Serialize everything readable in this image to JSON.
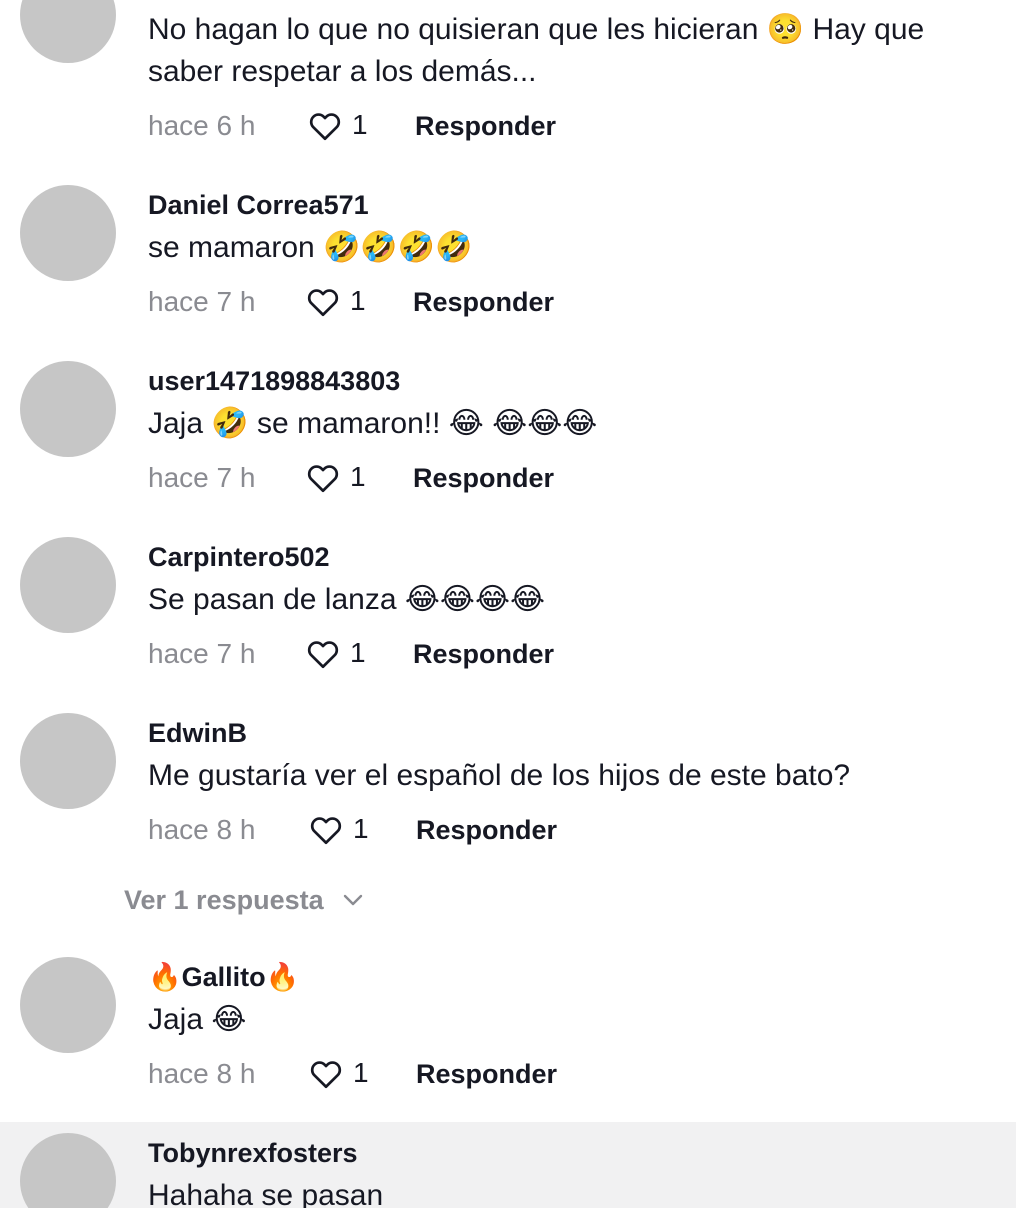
{
  "comments": [
    {
      "username": "",
      "text": "No hagan lo que no quisieran que les hicieran 🥺 Hay que saber respetar a los demás...",
      "time": "hace 6 h",
      "likes": "1",
      "reply_label": "Responder"
    },
    {
      "username": "Daniel Correa571",
      "text": "se mamaron 🤣🤣🤣🤣",
      "time": "hace 7 h",
      "likes": "1",
      "reply_label": "Responder"
    },
    {
      "username": "user1471898843803",
      "text": "Jaja 🤣 se mamaron!! 😂 😂😂😂",
      "time": "hace 7 h",
      "likes": "1",
      "reply_label": "Responder"
    },
    {
      "username": "Carpintero502",
      "text": "Se pasan de lanza 😂😂😂😂",
      "time": "hace 7 h",
      "likes": "1",
      "reply_label": "Responder"
    },
    {
      "username": "EdwinB",
      "text": "Me gustaría ver el español de los hijos de este bato?",
      "time": "hace 8 h",
      "likes": "1",
      "reply_label": "Responder"
    },
    {
      "username": "🔥Gallito🔥",
      "text": "Jaja 😂",
      "time": "hace 8 h",
      "likes": "1",
      "reply_label": "Responder"
    },
    {
      "username": "Tobynrexfosters",
      "text": "Hahaha se pasan"
    }
  ],
  "view_replies_label": "Ver 1 respuesta",
  "icons": {
    "like": "heart-outline-icon",
    "expand": "chevron-down-icon"
  },
  "colors": {
    "primary_text": "#161823",
    "secondary_text": "#8a8b91",
    "avatar_placeholder": "#c6c6c6",
    "bottom_shade": "#f1f1f2"
  }
}
